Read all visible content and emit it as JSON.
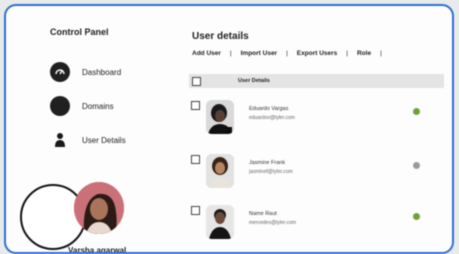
{
  "sidebar": {
    "title": "Control Panel",
    "items": [
      {
        "label": "Dashboard",
        "icon": "dashboard-icon"
      },
      {
        "label": "Domains",
        "icon": "domains-icon"
      },
      {
        "label": "User Details",
        "icon": "user-icon"
      }
    ],
    "user_name": "Varsha agarwal"
  },
  "main": {
    "title": "User details",
    "actions": [
      "Add User",
      "Import User",
      "Export Users",
      "Role"
    ],
    "header_label": "User Details",
    "users": [
      {
        "name": "Eduardo Vargas",
        "email": "eduardov@tyler.com",
        "status": "green",
        "status_color": "#6fa236"
      },
      {
        "name": "Jasmine Frank",
        "email": "jasminef@tyler.com",
        "status": "gray",
        "status_color": "#9a9a9a"
      },
      {
        "name": "Name Raut",
        "email": "mercedes@tyler.com",
        "status": "green",
        "status_color": "#6fa236"
      }
    ]
  },
  "colors": {
    "frame_border": "#2f6fd2",
    "status_green": "#6fa236",
    "status_gray": "#9a9a9a"
  }
}
